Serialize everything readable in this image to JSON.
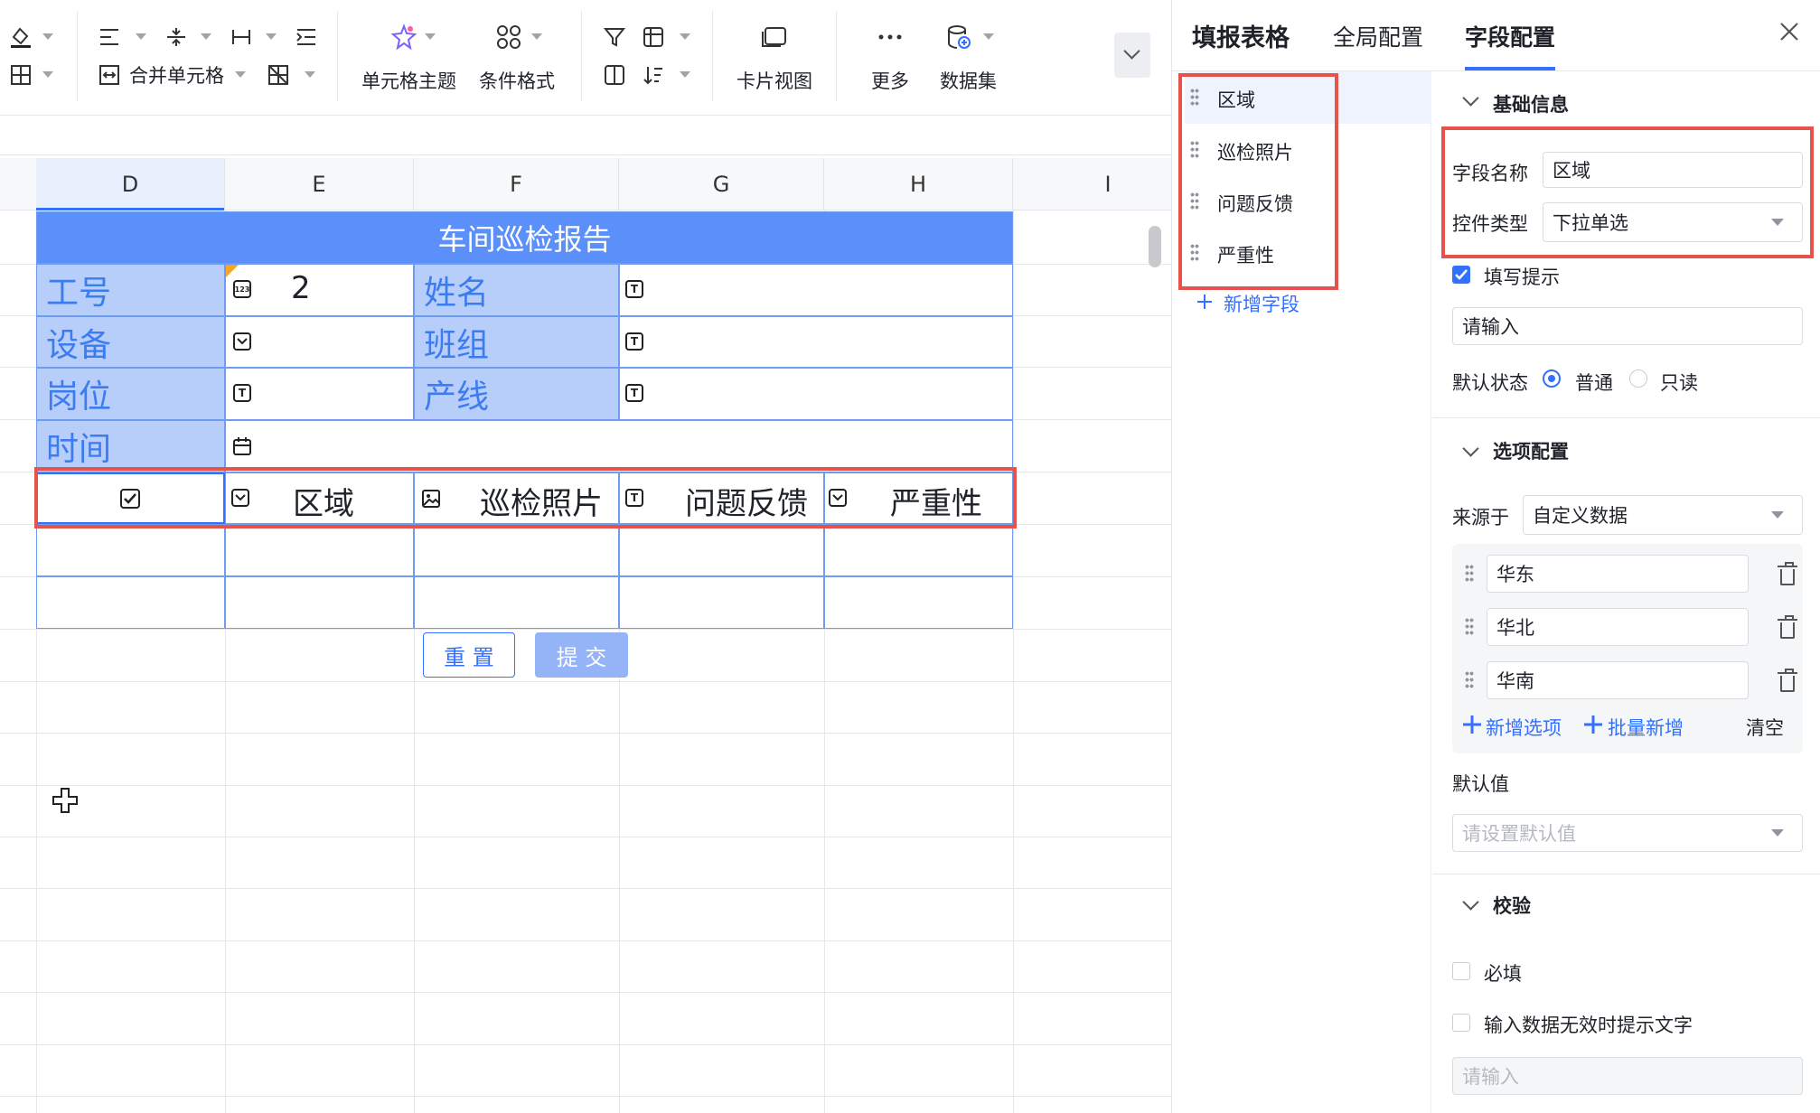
{
  "toolbar": {
    "merge_cells": "合并单元格",
    "cell_theme": "单元格主题",
    "conditional_format": "条件格式",
    "card_view": "卡片视图",
    "more": "更多",
    "dataset": "数据集"
  },
  "sheet": {
    "columns": [
      "D",
      "E",
      "F",
      "G",
      "H",
      "I"
    ],
    "title": "车间巡检报告",
    "labels": {
      "employee_id": "工号",
      "name": "姓名",
      "device": "设备",
      "team": "班组",
      "post": "岗位",
      "line": "产线",
      "time": "时间"
    },
    "employee_id_value": "2",
    "field_row": [
      "区域",
      "巡检照片",
      "问题反馈",
      "严重性"
    ],
    "reset_button": "重 置",
    "submit_button": "提 交"
  },
  "panel": {
    "tabs": [
      "填报表格",
      "全局配置",
      "字段配置"
    ],
    "active_tab": "字段配置",
    "fields": [
      "区域",
      "巡检照片",
      "问题反馈",
      "严重性"
    ],
    "add_field": "新增字段",
    "basic_info": {
      "section_title": "基础信息",
      "field_name_label": "字段名称",
      "field_name_value": "区域",
      "control_type_label": "控件类型",
      "control_type_value": "下拉单选",
      "hint_checkbox": "填写提示",
      "hint_placeholder": "请输入",
      "default_state_label": "默认状态",
      "state_normal": "普通",
      "state_readonly": "只读"
    },
    "options": {
      "section_title": "选项配置",
      "source_label": "来源于",
      "source_value": "自定义数据",
      "items": [
        "华东",
        "华北",
        "华南"
      ],
      "add_option": "新增选项",
      "batch_add": "批量新增",
      "clear": "清空",
      "default_label": "默认值",
      "default_placeholder": "请设置默认值"
    },
    "validation": {
      "section_title": "校验",
      "required": "必填",
      "invalid_hint": "输入数据无效时提示文字",
      "invalid_placeholder": "请输入"
    }
  },
  "colors": {
    "accent": "#3370ff",
    "header_blue": "#5b8ff9",
    "label_bg": "#b7cdfa",
    "highlight_red": "#e5534b"
  }
}
